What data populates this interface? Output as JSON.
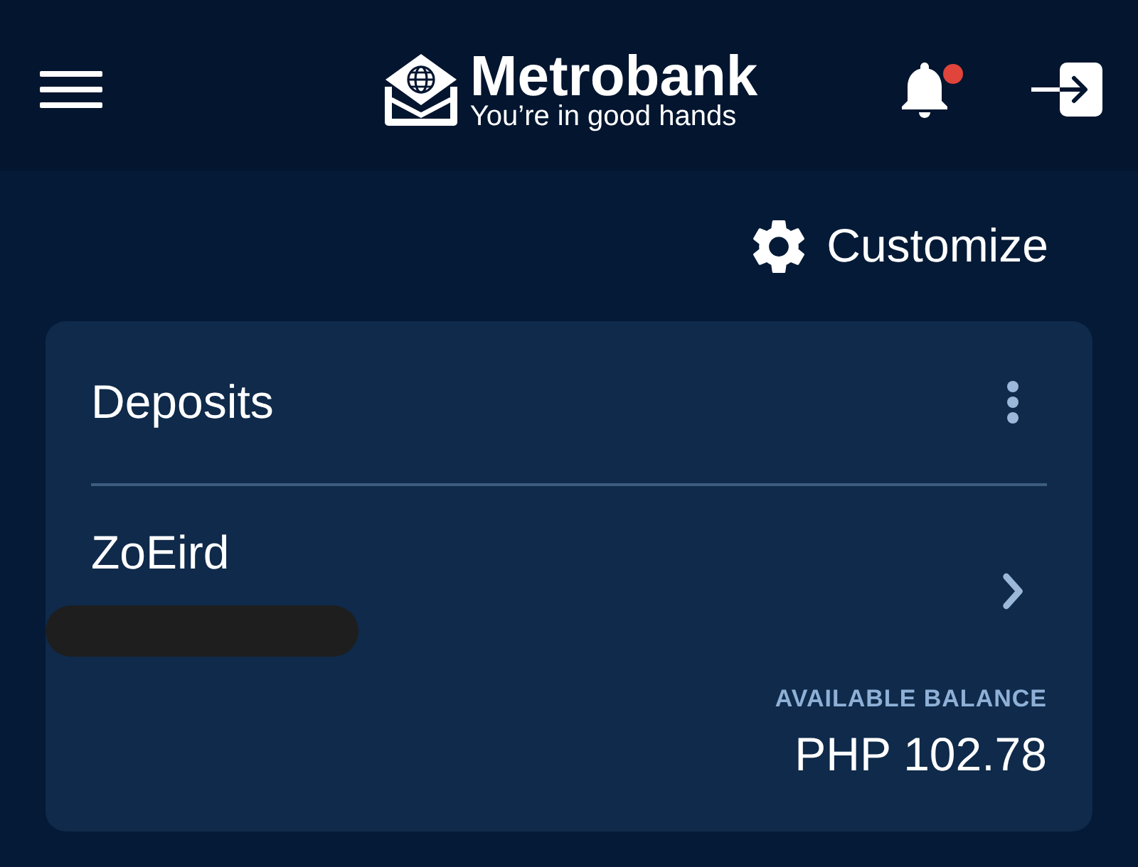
{
  "header": {
    "logo": {
      "name": "Metrobank",
      "tagline": "You’re in good hands"
    },
    "notifications": {
      "unread": true
    }
  },
  "toolbar": {
    "customize_label": "Customize"
  },
  "deposits_card": {
    "title": "Deposits",
    "accounts": [
      {
        "name": "ZoEird",
        "number_redacted": true,
        "balance_label": "AVAILABLE BALANCE",
        "balance": "PHP 102.78"
      }
    ]
  }
}
